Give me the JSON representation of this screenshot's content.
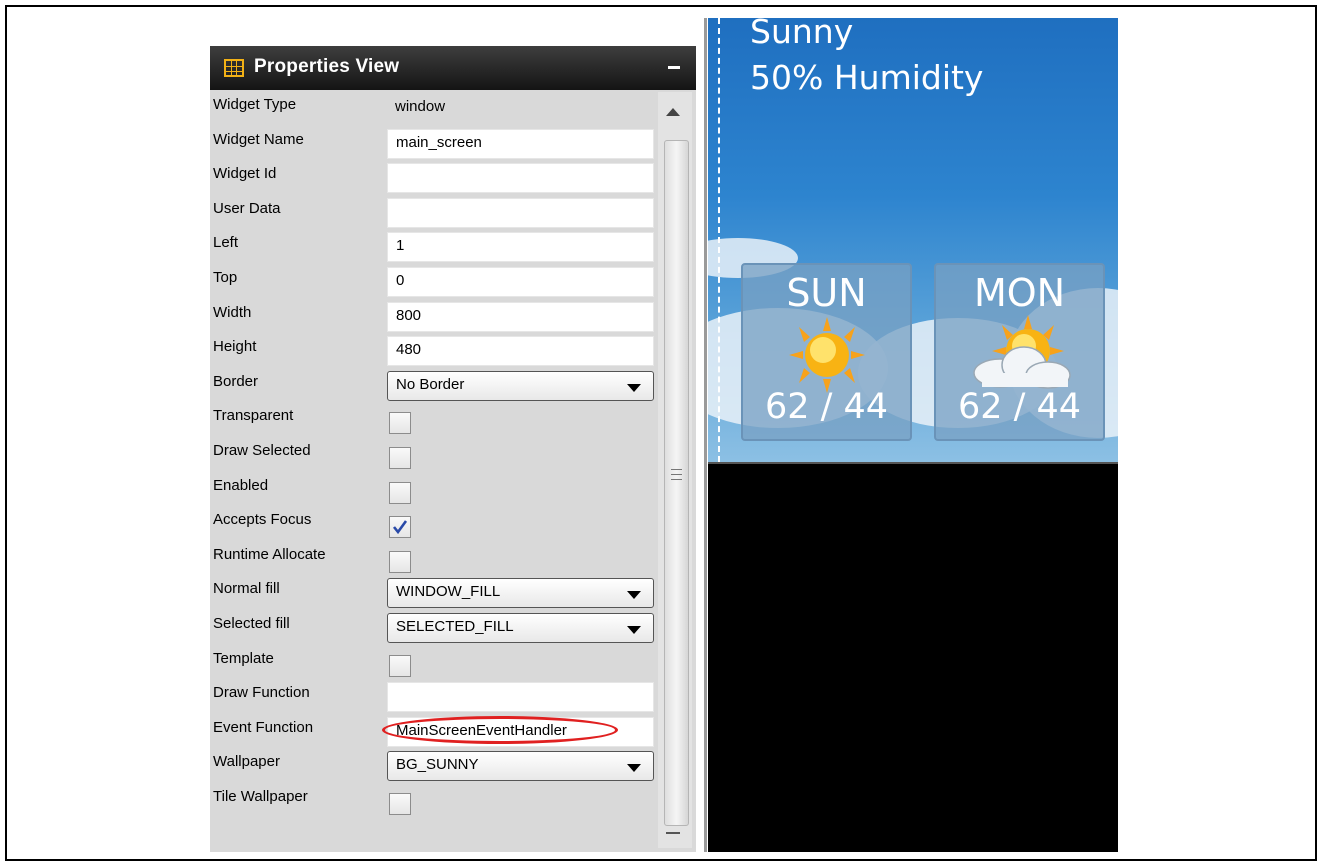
{
  "panel": {
    "title": "Properties View",
    "rows": [
      {
        "label": "Widget Type",
        "value": "window",
        "kind": "plain"
      },
      {
        "label": "Widget Name",
        "value": "main_screen",
        "kind": "text"
      },
      {
        "label": "Widget Id",
        "value": "",
        "kind": "text"
      },
      {
        "label": "User Data",
        "value": "",
        "kind": "text"
      },
      {
        "label": "Left",
        "value": "1",
        "kind": "text"
      },
      {
        "label": "Top",
        "value": "0",
        "kind": "text"
      },
      {
        "label": "Width",
        "value": "800",
        "kind": "text"
      },
      {
        "label": "Height",
        "value": "480",
        "kind": "text"
      },
      {
        "label": "Border",
        "value": "No Border",
        "kind": "select"
      },
      {
        "label": "Transparent",
        "checked": false,
        "kind": "check"
      },
      {
        "label": "Draw Selected",
        "checked": false,
        "kind": "check"
      },
      {
        "label": "Enabled",
        "checked": false,
        "kind": "check"
      },
      {
        "label": "Accepts Focus",
        "checked": true,
        "kind": "check"
      },
      {
        "label": "Runtime Allocate",
        "checked": false,
        "kind": "check"
      },
      {
        "label": "Normal fill",
        "value": "WINDOW_FILL",
        "kind": "select"
      },
      {
        "label": "Selected fill",
        "value": "SELECTED_FILL",
        "kind": "select"
      },
      {
        "label": "Template",
        "checked": false,
        "kind": "check"
      },
      {
        "label": "Draw Function",
        "value": "",
        "kind": "text"
      },
      {
        "label": "Event Function",
        "value": "MainScreenEventHandler",
        "kind": "text",
        "highlighted": true
      },
      {
        "label": "Wallpaper",
        "value": "BG_SUNNY",
        "kind": "select"
      },
      {
        "label": "Tile Wallpaper",
        "checked": false,
        "kind": "check"
      }
    ]
  },
  "preview": {
    "condition": "Sunny",
    "humidity": "50% Humidity",
    "forecast": [
      {
        "day": "SUN",
        "temps": "62 / 44",
        "icon": "sun-icon"
      },
      {
        "day": "MON",
        "temps": "62 / 44",
        "icon": "partly-cloudy-icon"
      }
    ]
  },
  "colors": {
    "highlight": "#e02020",
    "header": "#141414",
    "icon_accent": "#f2b116"
  }
}
